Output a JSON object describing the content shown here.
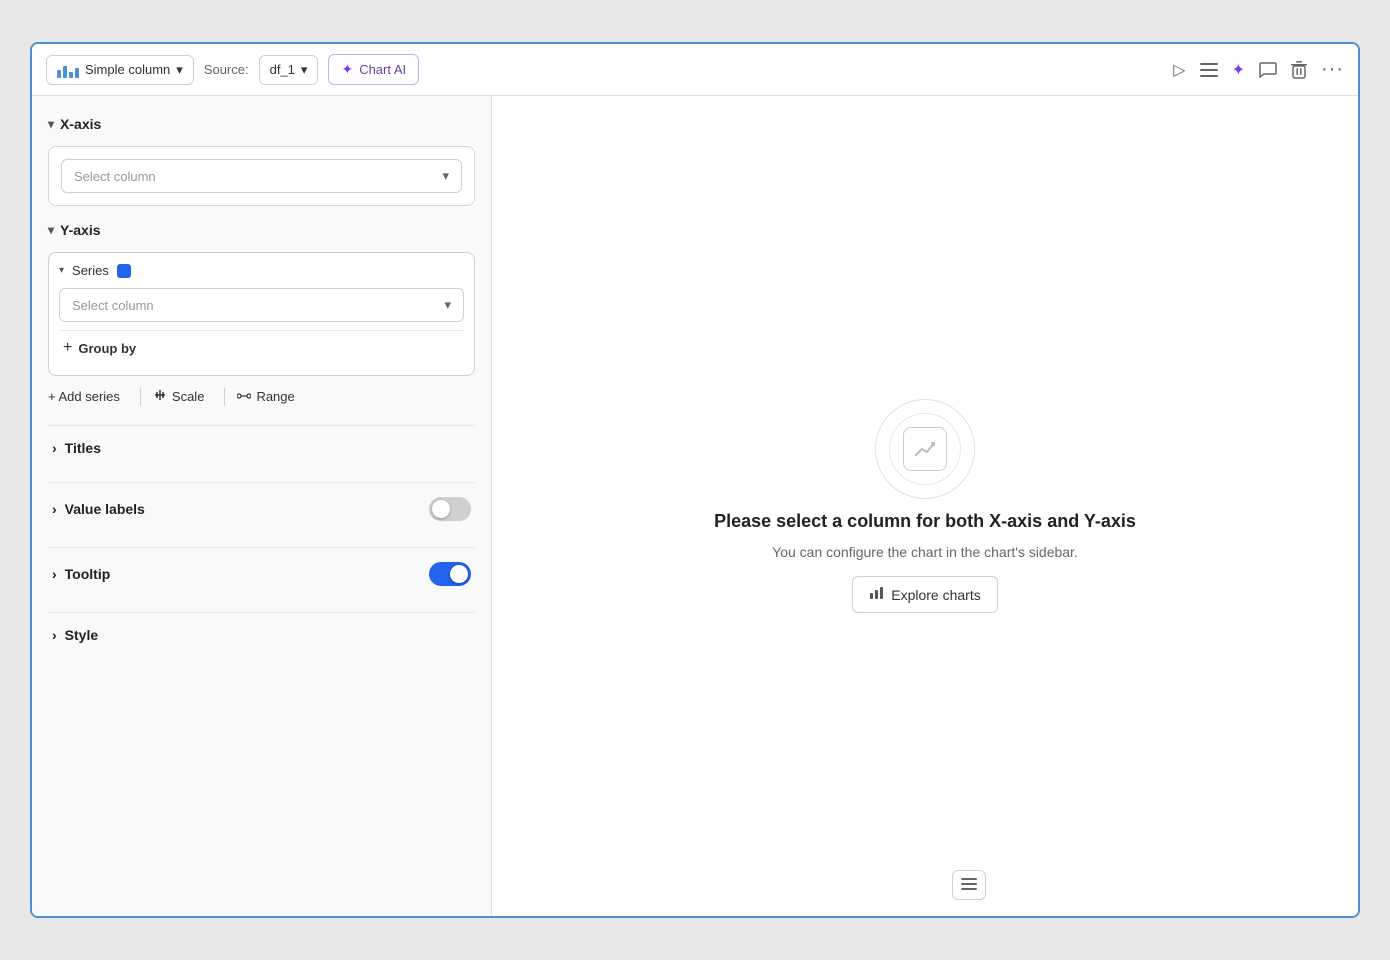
{
  "toolbar": {
    "chart_type_label": "Simple column",
    "source_label": "Source:",
    "source_value": "df_1",
    "chart_ai_label": "Chart AI",
    "icons": {
      "run": "▷",
      "list": "≡",
      "sparkle": "✦",
      "comment": "💬",
      "delete": "🗑",
      "more": "…"
    }
  },
  "sidebar": {
    "x_axis": {
      "label": "X-axis",
      "select_placeholder": "Select column"
    },
    "y_axis": {
      "label": "Y-axis",
      "series_label": "Series",
      "select_placeholder": "Select column",
      "group_by_label": "Group by",
      "add_series_label": "+ Add series",
      "scale_label": "Scale",
      "range_label": "Range"
    },
    "titles": {
      "label": "Titles"
    },
    "value_labels": {
      "label": "Value labels",
      "toggle_state": "off"
    },
    "tooltip": {
      "label": "Tooltip",
      "toggle_state": "on"
    },
    "style": {
      "label": "Style"
    }
  },
  "chart_area": {
    "empty_title": "Please select a column for both X-axis and Y-axis",
    "empty_subtitle": "You can configure the chart in the chart's sidebar.",
    "explore_btn_label": "Explore charts"
  }
}
